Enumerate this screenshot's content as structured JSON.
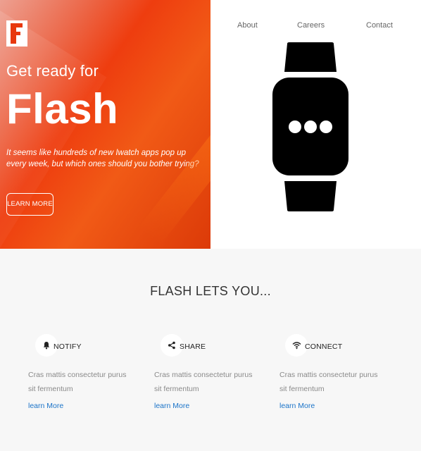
{
  "hero": {
    "pretitle": "Get ready for",
    "title": "Flash",
    "tagline": "It seems like hundreds of new Iwatch apps pop up every week, but which ones should you bother trying?",
    "button_label": "LEARN MORE",
    "gradient_colors": [
      "#eda091",
      "#ee3d0f",
      "#f15a16",
      "#dc3a08"
    ]
  },
  "logo": {
    "name": "flash-logo",
    "accent": "#e8380d"
  },
  "nav": {
    "items": [
      {
        "label": "About"
      },
      {
        "label": "Careers"
      },
      {
        "label": "Contact"
      }
    ]
  },
  "illustration": {
    "name": "smartwatch-icon"
  },
  "features_section": {
    "title": "FLASH LETS YOU...",
    "features": [
      {
        "icon": "bell-icon",
        "label": "NOTIFY",
        "text": "Cras mattis consectetur purus sit fermentum",
        "link": "learn More"
      },
      {
        "icon": "share-icon",
        "label": "SHARE",
        "text": "Cras mattis consectetur purus sit fermentum",
        "link": "learn More"
      },
      {
        "icon": "wifi-icon",
        "label": "CONNECT",
        "text": "Cras mattis consectetur purus sit fermentum",
        "link": "learn More"
      }
    ]
  },
  "colors": {
    "link": "#1a73c8",
    "section_bg": "#f7f7f7"
  }
}
